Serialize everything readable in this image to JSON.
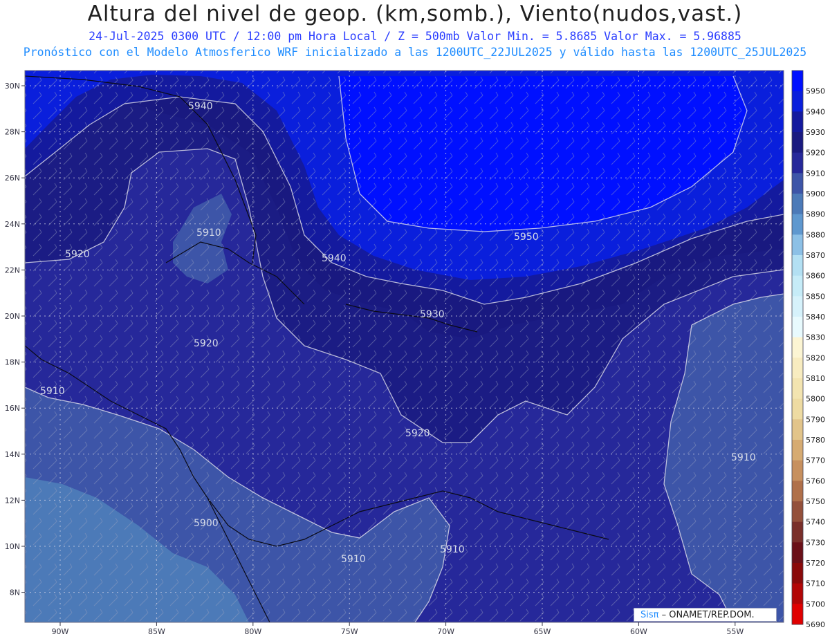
{
  "header": {
    "title": "Altura del nivel de geop. (km,somb.), Viento(nudos,vast.)",
    "subtitle": "24-Jul-2025  0300 UTC / 12:00 pm Hora Local / Z = 500mb    Valor Min. = 5.8685  Valor Max. = 5.96885",
    "model_info": "Pronóstico con el Modelo Atmosferico WRF inicializado a las 1200UTC_22JUL2025 y válido hasta las  1200UTC_25JUL2025"
  },
  "map": {
    "lon_labels": [
      "90W",
      "85W",
      "80W",
      "75W",
      "70W",
      "65W",
      "60W",
      "55W"
    ],
    "lat_labels": [
      "30N",
      "28N",
      "26N",
      "24N",
      "22N",
      "20N",
      "18N",
      "16N",
      "14N",
      "12N",
      "10N",
      "8N"
    ],
    "contour_labels": [
      "5940",
      "5910",
      "5920",
      "5950",
      "5940",
      "5930",
      "5920",
      "5910",
      "5920",
      "5910",
      "5900",
      "5910",
      "5910"
    ]
  },
  "colorbar": {
    "levels": [
      "5950",
      "5940",
      "5930",
      "5920",
      "5910",
      "5900",
      "5890",
      "5880",
      "5870",
      "5860",
      "5850",
      "5840",
      "5830",
      "5820",
      "5810",
      "5800",
      "5790",
      "5780",
      "5770",
      "5760",
      "5750",
      "5740",
      "5730",
      "5720",
      "5710",
      "5700",
      "5690"
    ],
    "colors": [
      "#0010ff",
      "#0a1fdc",
      "#141a9e",
      "#1a1a80",
      "#26289a",
      "#3d55a8",
      "#4c7ab8",
      "#5f98cf",
      "#8cc0e6",
      "#b3e0f3",
      "#c6ecf8",
      "#d6f2fb",
      "#e8fafd",
      "#fcf5d3",
      "#f8ecc0",
      "#f3e4b0",
      "#eedba2",
      "#e2c48a",
      "#d6ab72",
      "#c7905e",
      "#b0704a",
      "#94503b",
      "#7a2f2a",
      "#6b1018",
      "#8a0a0a",
      "#b20606",
      "#e00000"
    ]
  },
  "credit": {
    "brand": "Sisπ",
    "org": "– ONAMET/REP.DOM."
  },
  "colors": {
    "strongHigh": "#0010ff",
    "title_blue": "#2a3dff",
    "subtitle_cyan": "#1e8cff"
  }
}
